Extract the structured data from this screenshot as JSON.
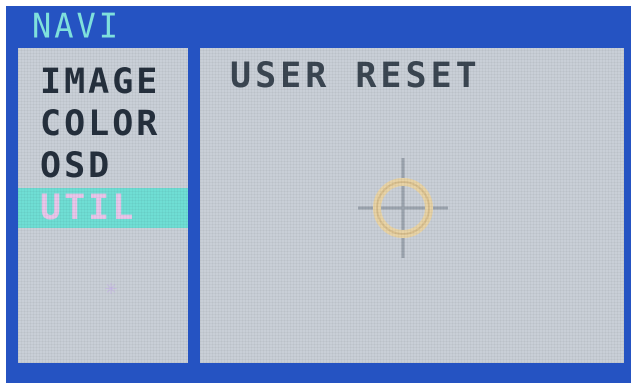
{
  "window": {
    "title": "NAVI"
  },
  "menu": {
    "items": [
      {
        "label": "IMAGE",
        "selected": false
      },
      {
        "label": "COLOR",
        "selected": false
      },
      {
        "label": "OSD",
        "selected": false
      },
      {
        "label": "UTIL",
        "selected": true
      }
    ],
    "marker_icon": "asterisk-icon"
  },
  "content": {
    "title": "USER RESET",
    "icon": "reset-target-icon"
  },
  "colors": {
    "frame": "#2553c2",
    "panel": "#c9cfd7",
    "title_text": "#7fe0dc",
    "highlight": "#6fded4",
    "highlight_text": "#e8c6ea",
    "menu_text": "#25303d"
  }
}
